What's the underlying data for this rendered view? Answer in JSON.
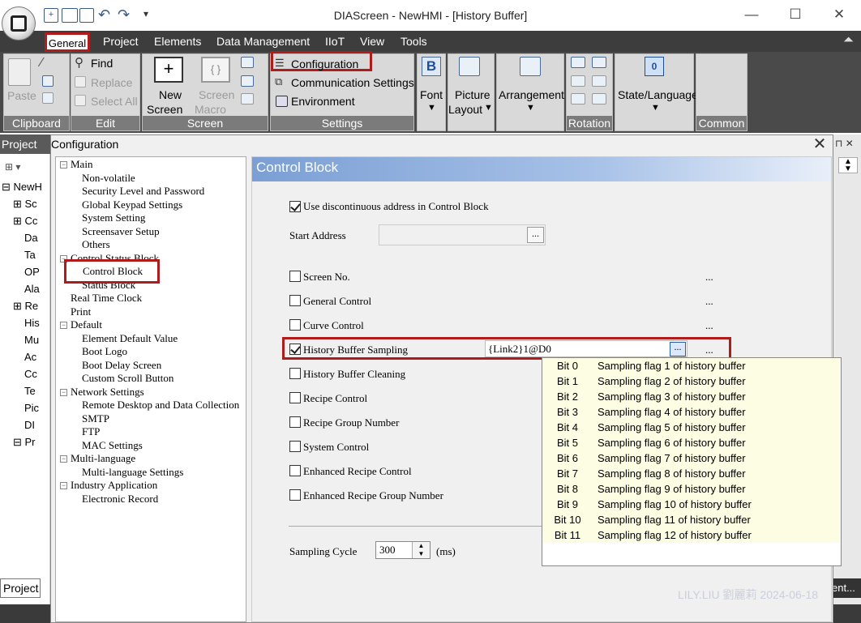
{
  "window": {
    "title": "DIAScreen - NewHMI - [History Buffer]"
  },
  "quick_access": {
    "icons": [
      "new-screen-icon",
      "open-icon",
      "save-icon",
      "undo-icon",
      "redo-icon",
      "customize-dropdown-icon"
    ],
    "dropdown_glyph": "▾"
  },
  "window_buttons": {
    "minimize": "—",
    "maximize": "☐",
    "close": "✕"
  },
  "menu": {
    "items": [
      "General",
      "Project",
      "Elements",
      "Data Management",
      "IIoT",
      "View",
      "Tools"
    ]
  },
  "ribbon": {
    "clipboard": {
      "paste": "Paste",
      "label": "Clipboard"
    },
    "edit": {
      "find": "Find",
      "replace": "Replace",
      "select_all": "Select All",
      "label": "Edit"
    },
    "screen": {
      "new_screen_1": "New",
      "new_screen_2": "Screen",
      "screen_macro_1": "Screen",
      "screen_macro_2": "Macro",
      "label": "Screen"
    },
    "settings": {
      "configuration": "Configuration",
      "communication": "Communication Settings",
      "environment": "Environment",
      "label": "Settings"
    },
    "font": {
      "label": "Font"
    },
    "picture_layout": {
      "line1": "Picture",
      "line2": "Layout"
    },
    "arrangement": {
      "label": "Arrangement"
    },
    "rotation": {
      "label": "Rotation"
    },
    "state_language": {
      "label": "State/Language"
    },
    "common": {
      "label": "Common"
    }
  },
  "project_panel": {
    "header": "Project",
    "items": [
      "NewH",
      "Sc",
      "Cc",
      "Da",
      "Ta",
      "OP",
      "Ala",
      "Re",
      "His",
      "Mu",
      "Ac",
      "Cc",
      "Te",
      "Pic",
      "DI",
      "Pr"
    ],
    "bottom_tab": "Project",
    "right_tab": "ent..."
  },
  "dialog": {
    "title": "Configuration",
    "close": "✕",
    "tree": [
      {
        "label": "Main",
        "level": 0
      },
      {
        "label": "Non-volatile",
        "level": 1
      },
      {
        "label": "Security Level and Password",
        "level": 1
      },
      {
        "label": "Global Keypad Settings",
        "level": 1
      },
      {
        "label": "System Setting",
        "level": 1
      },
      {
        "label": "Screensaver Setup",
        "level": 1
      },
      {
        "label": "Others",
        "level": 1
      },
      {
        "label": "Control Status Block",
        "level": 0
      },
      {
        "label": "Control Block",
        "level": 1
      },
      {
        "label": "Status Block",
        "level": 1
      },
      {
        "label": "Real Time Clock",
        "level": 0
      },
      {
        "label": "Print",
        "level": 0
      },
      {
        "label": "Default",
        "level": 0
      },
      {
        "label": "Element Default Value",
        "level": 1
      },
      {
        "label": "Boot Logo",
        "level": 1
      },
      {
        "label": "Boot Delay Screen",
        "level": 1
      },
      {
        "label": "Custom Scroll Button",
        "level": 1
      },
      {
        "label": "Network Settings",
        "level": 0
      },
      {
        "label": "Remote Desktop and Data Collection",
        "level": 1
      },
      {
        "label": "SMTP",
        "level": 1
      },
      {
        "label": "FTP",
        "level": 1
      },
      {
        "label": "MAC Settings",
        "level": 1
      },
      {
        "label": "Multi-language",
        "level": 0
      },
      {
        "label": "Multi-language Settings",
        "level": 1
      },
      {
        "label": "Industry Application",
        "level": 0
      },
      {
        "label": "Electronic Record",
        "level": 1
      }
    ],
    "panel_title": "Control Block",
    "use_discontinuous": {
      "label": "Use discontinuous address in Control Block",
      "checked": true
    },
    "start_address": {
      "label": "Start Address",
      "value": "",
      "button": "..."
    },
    "options": [
      {
        "label": "Screen No.",
        "checked": false,
        "dots": "..."
      },
      {
        "label": "General Control",
        "checked": false,
        "dots": "..."
      },
      {
        "label": "Curve Control",
        "checked": false,
        "dots": "..."
      },
      {
        "label": "History Buffer Sampling",
        "checked": true,
        "dots": "...",
        "value": "{Link2}1@D0",
        "button": "..."
      },
      {
        "label": "History Buffer Cleaning",
        "checked": false
      },
      {
        "label": "Recipe Control",
        "checked": false
      },
      {
        "label": "Recipe Group Number",
        "checked": false
      },
      {
        "label": "System Control",
        "checked": false
      },
      {
        "label": "Enhanced Recipe Control",
        "checked": false
      },
      {
        "label": "Enhanced Recipe Group Number",
        "checked": false
      }
    ],
    "sampling_cycle": {
      "label": "Sampling Cycle",
      "value": "300",
      "unit": "(ms)"
    },
    "bit_popup": [
      {
        "bit": "Bit 0",
        "desc": "Sampling flag 1 of history buffer"
      },
      {
        "bit": "Bit 1",
        "desc": "Sampling flag 2 of history buffer"
      },
      {
        "bit": "Bit 2",
        "desc": "Sampling flag 3 of history buffer"
      },
      {
        "bit": "Bit 3",
        "desc": "Sampling flag 4 of history buffer"
      },
      {
        "bit": "Bit 4",
        "desc": "Sampling flag 5 of history buffer"
      },
      {
        "bit": "Bit 5",
        "desc": "Sampling flag 6 of history buffer"
      },
      {
        "bit": "Bit 6",
        "desc": "Sampling flag 7 of history buffer"
      },
      {
        "bit": "Bit 7",
        "desc": "Sampling flag 8 of history buffer"
      },
      {
        "bit": "Bit 8",
        "desc": "Sampling flag 9 of history buffer"
      },
      {
        "bit": "Bit 9",
        "desc": "Sampling flag 10 of history buffer"
      },
      {
        "bit": "Bit 10",
        "desc": "Sampling flag 11 of history buffer"
      },
      {
        "bit": "Bit 11",
        "desc": "Sampling flag 12 of history buffer"
      }
    ]
  },
  "watermark": "LILY.LIU 劉麗莉 2024-06-18",
  "colors": {
    "highlight_red": "#b01c1c",
    "header_blue": "#7b9fd4",
    "popup_yellow": "#fdfde4"
  }
}
